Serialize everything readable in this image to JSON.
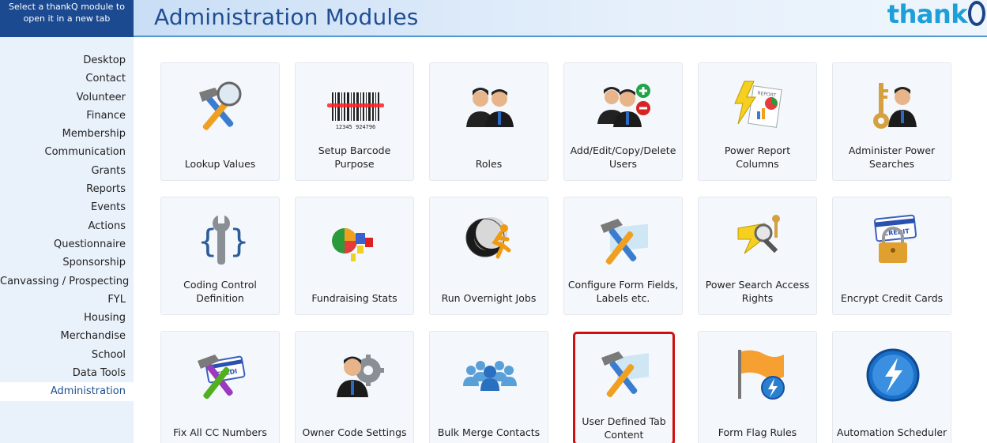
{
  "sidebar": {
    "header": "Select a thankQ module to open it in a new tab",
    "items": [
      {
        "label": "Desktop"
      },
      {
        "label": "Contact"
      },
      {
        "label": "Volunteer"
      },
      {
        "label": "Finance"
      },
      {
        "label": "Membership"
      },
      {
        "label": "Communication"
      },
      {
        "label": "Grants"
      },
      {
        "label": "Reports"
      },
      {
        "label": "Events"
      },
      {
        "label": "Actions"
      },
      {
        "label": "Questionnaire"
      },
      {
        "label": "Sponsorship"
      },
      {
        "label": "Canvassing / Prospecting"
      },
      {
        "label": "FYL"
      },
      {
        "label": "Housing"
      },
      {
        "label": "Merchandise"
      },
      {
        "label": "School"
      },
      {
        "label": "Data Tools"
      },
      {
        "label": "Administration",
        "active": true
      }
    ]
  },
  "header": {
    "title": "Administration Modules",
    "logo": "thank"
  },
  "tiles": [
    {
      "label": "Lookup Values",
      "icon": "magnifier-tools-icon"
    },
    {
      "label": "Setup Barcode Purpose",
      "icon": "barcode-icon",
      "barcode_text": "12345 924796"
    },
    {
      "label": "Roles",
      "icon": "users-pair-icon"
    },
    {
      "label": "Add/Edit/Copy/Delete Users",
      "icon": "users-add-remove-icon"
    },
    {
      "label": "Power Report Columns",
      "icon": "power-report-icon",
      "report_text": "REPORT"
    },
    {
      "label": "Administer Power Searches",
      "icon": "key-user-icon"
    },
    {
      "label": "Coding Control Definition",
      "icon": "wrench-braces-icon"
    },
    {
      "label": "Fundraising Stats",
      "icon": "stats-chart-icon"
    },
    {
      "label": "Run Overnight Jobs",
      "icon": "night-runner-icon"
    },
    {
      "label": "Configure Form Fields, Labels etc.",
      "icon": "tools-form-icon"
    },
    {
      "label": "Power Search Access Rights",
      "icon": "search-key-icon"
    },
    {
      "label": "Encrypt Credit Cards",
      "icon": "credit-lock-icon",
      "card_text": "CREDIT"
    },
    {
      "label": "Fix All CC Numbers",
      "icon": "tools-card-icon",
      "card_text": "CREDI"
    },
    {
      "label": "Owner Code Settings",
      "icon": "user-gear-icon"
    },
    {
      "label": "Bulk Merge Contacts",
      "icon": "group-merge-icon"
    },
    {
      "label": "User Defined Tab Content",
      "icon": "tools-tab-icon",
      "highlighted": true
    },
    {
      "label": "Form Flag Rules",
      "icon": "flag-bolt-icon"
    },
    {
      "label": "Automation Scheduler",
      "icon": "bolt-globe-icon"
    }
  ],
  "colors": {
    "accent": "#1f4e93",
    "logo_blue": "#1d9fd8",
    "highlight_red": "#d01010"
  }
}
